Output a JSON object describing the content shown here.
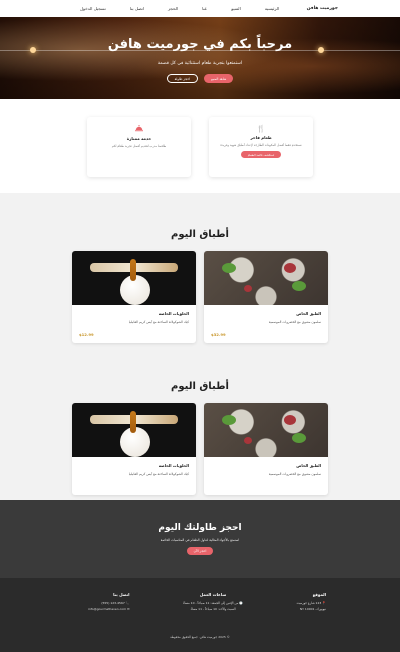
{
  "nav": {
    "brand": "جورميت هافن",
    "links": [
      "الرئيسية",
      "المنيو",
      "عنا",
      "الحجز",
      "اتصل بنا",
      "تسجيل الدخول"
    ]
  },
  "hero": {
    "title": "مرحباً بكم في جورميت هافن",
    "subtitle": "استمتعوا بتجربة طعام استثنائية في كل قضمة",
    "primary_button": "شاهد المنيو",
    "secondary_button": "احجز طاولة"
  },
  "features": [
    {
      "icon": "utensils-icon",
      "title": "طعام فاخر",
      "desc": "نستخدم فقط أفضل المكونات الطازجة لإعداد أطباق شهية وفريدة",
      "button": "استكشف قائمة الطعام"
    },
    {
      "icon": "cloche-icon",
      "title": "خدمة ممتازة",
      "desc": "طاقمنا مدرب لتقديم أفضل تجربة طعام لكم"
    }
  ],
  "dishes_sections": [
    {
      "title": "أطباق اليوم",
      "items": [
        {
          "title": "الطبق الخاص",
          "desc": "سلمون مشوي مع الخضروات الموسمية",
          "price": "$32.99"
        },
        {
          "title": "الحلويات الخاصة",
          "desc": "كيك الشوكولاتة الساخنة مع آيس كريم الفانيليا",
          "price": "$12.99"
        }
      ]
    },
    {
      "title": "أطباق اليوم",
      "items": [
        {
          "title": "الطبق الخاص",
          "desc": "سلمون مشوي مع الخضروات الموسمية"
        },
        {
          "title": "الحلويات الخاصة",
          "desc": "كيك الشوكولاتة الساخنة مع آيس كريم الفانيليا"
        }
      ]
    }
  ],
  "reserve": {
    "title": "احجز طاولتك اليوم",
    "subtitle": "استمتع بالأجواء المثالية لتناول الطعام في المناسبات الخاصة",
    "button": "احجز الآن"
  },
  "footer": {
    "location_title": "الموقع",
    "location_lines": [
      "123 شارع جورميت",
      "نيويورك، NY 10001"
    ],
    "hours_title": "ساعات العمل",
    "hours_lines": [
      "من الإثنين إلى الجمعة: 11 صباحاً - 10 مساءً",
      "السبت والأحد: 10 صباحاً - 11 مساءً"
    ],
    "contact_title": "اتصل بنا",
    "contact_lines": [
      "123-4567 (555)",
      "info@gourmethaven.com"
    ],
    "copyright": "© 2025 جورميت هافن. جميع الحقوق محفوظة"
  },
  "colors": {
    "accent": "#e8646a",
    "price": "#c8962a",
    "dark": "#3a3a3a",
    "footer": "#2b2b2b"
  }
}
